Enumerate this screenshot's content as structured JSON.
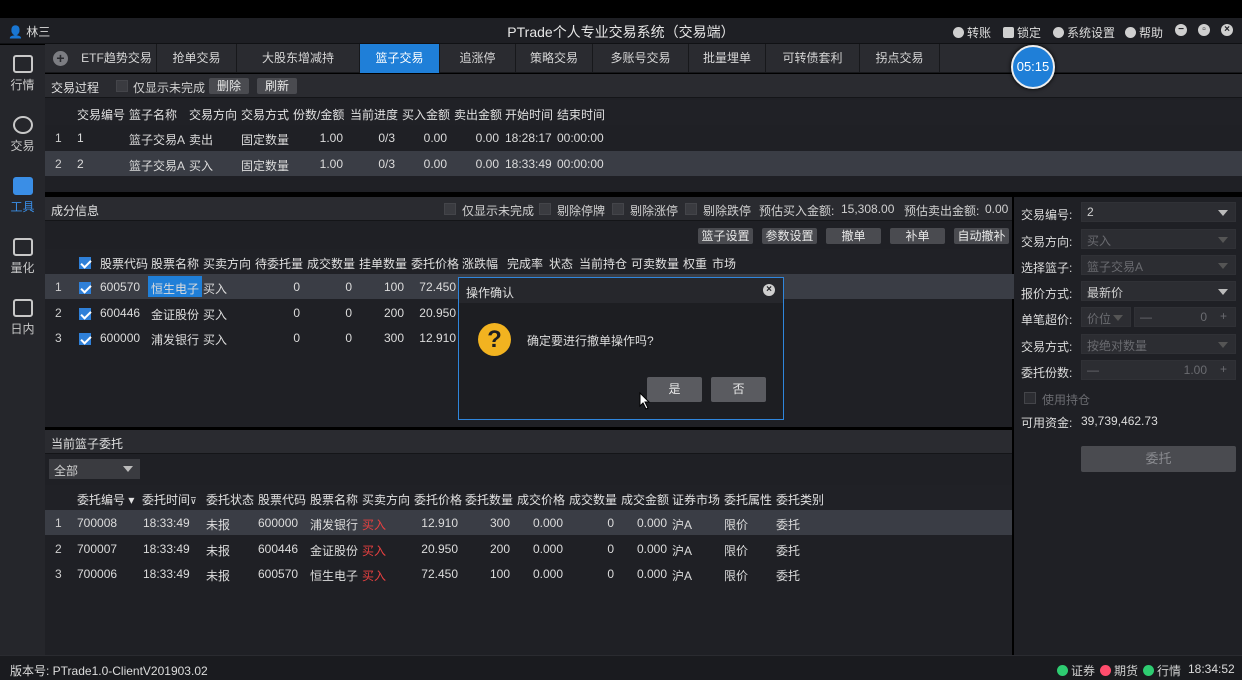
{
  "window": {
    "user": "林三",
    "title": "PTrade个人专业交易系统（交易端）",
    "actions": [
      "转账",
      "锁定",
      "系统设置",
      "帮助"
    ]
  },
  "sidebar": [
    {
      "label": "行情",
      "icon": "chart-icon"
    },
    {
      "label": "交易",
      "icon": "yen-icon"
    },
    {
      "label": "工具",
      "icon": "toolbox-icon"
    },
    {
      "label": "量化",
      "icon": "quant-icon"
    },
    {
      "label": "日内",
      "icon": "intraday-icon"
    }
  ],
  "tabs": [
    "ETF趋势交易",
    "抢单交易",
    "大股东增减持",
    "篮子交易",
    "追涨停",
    "策略交易",
    "多账号交易",
    "批量埋单",
    "可转债套利",
    "拐点交易"
  ],
  "active_tab": "篮子交易",
  "timer": "05:15",
  "process": {
    "title": "交易过程",
    "only_unfinished": "仅显示未完成",
    "delete_btn": "删除",
    "refresh_btn": "刷新",
    "headers": [
      "交易编号",
      "篮子名称",
      "交易方向",
      "交易方式",
      "份数/金额",
      "当前进度",
      "买入金额",
      "卖出金额",
      "开始时间",
      "结束时间"
    ],
    "rows": [
      {
        "n": "1",
        "id": "1",
        "name": "篮子交易A",
        "dir": "卖出",
        "mode": "固定数量",
        "qty": "1.00",
        "prog": "0/3",
        "buy": "0.00",
        "sell": "0.00",
        "start": "18:28:17",
        "end": "00:00:00"
      },
      {
        "n": "2",
        "id": "2",
        "name": "篮子交易A",
        "dir": "买入",
        "mode": "固定数量",
        "qty": "1.00",
        "prog": "0/3",
        "buy": "0.00",
        "sell": "0.00",
        "start": "18:33:49",
        "end": "00:00:00"
      }
    ]
  },
  "components": {
    "title": "成分信息",
    "filters": [
      "仅显示未完成",
      "剔除停牌",
      "剔除涨停",
      "剔除跌停"
    ],
    "est_buy_label": "预估买入金额:",
    "est_buy": "15,308.00",
    "est_sell_label": "预估卖出金额:",
    "est_sell": "0.00",
    "buttons": [
      "篮子设置",
      "参数设置",
      "撤单",
      "补单",
      "自动撤补"
    ],
    "headers": [
      "股票代码",
      "股票名称",
      "买卖方向",
      "待委托量",
      "成交数量",
      "挂单数量",
      "委托价格",
      "涨跌幅",
      "完成率",
      "状态",
      "当前持仓",
      "可卖数量",
      "权重",
      "市场"
    ],
    "rows": [
      {
        "n": "1",
        "code": "600570",
        "name": "恒生电子",
        "dir": "买入",
        "pending": "0",
        "filled": "0",
        "order": "100",
        "price": "72.450"
      },
      {
        "n": "2",
        "code": "600446",
        "name": "金证股份",
        "dir": "买入",
        "pending": "0",
        "filled": "0",
        "order": "200",
        "price": "20.950"
      },
      {
        "n": "3",
        "code": "600000",
        "name": "浦发银行",
        "dir": "买入",
        "pending": "0",
        "filled": "0",
        "order": "300",
        "price": "12.910"
      }
    ]
  },
  "dialog": {
    "title": "操作确认",
    "message": "确定要进行撤单操作吗?",
    "yes": "是",
    "no": "否"
  },
  "orders": {
    "title": "当前篮子委托",
    "filter": "全部",
    "headers": [
      "委托编号",
      "委托时间",
      "委托状态",
      "股票代码",
      "股票名称",
      "买卖方向",
      "委托价格",
      "委托数量",
      "成交价格",
      "成交数量",
      "成交金额",
      "证券市场",
      "委托属性",
      "委托类别"
    ],
    "rows": [
      {
        "n": "1",
        "id": "700008",
        "time": "18:33:49",
        "status": "未报",
        "code": "600000",
        "name": "浦发银行",
        "dir": "买入",
        "price": "12.910",
        "qty": "300",
        "fprice": "0.000",
        "fqty": "0",
        "famt": "0.000",
        "mkt": "沪A",
        "attr": "限价",
        "type": "委托"
      },
      {
        "n": "2",
        "id": "700007",
        "time": "18:33:49",
        "status": "未报",
        "code": "600446",
        "name": "金证股份",
        "dir": "买入",
        "price": "20.950",
        "qty": "200",
        "fprice": "0.000",
        "fqty": "0",
        "famt": "0.000",
        "mkt": "沪A",
        "attr": "限价",
        "type": "委托"
      },
      {
        "n": "3",
        "id": "700006",
        "time": "18:33:49",
        "status": "未报",
        "code": "600570",
        "name": "恒生电子",
        "dir": "买入",
        "price": "72.450",
        "qty": "100",
        "fprice": "0.000",
        "fqty": "0",
        "famt": "0.000",
        "mkt": "沪A",
        "attr": "限价",
        "type": "委托"
      }
    ]
  },
  "right_panel": {
    "trade_no_label": "交易编号:",
    "trade_no": "2",
    "direction_label": "交易方向:",
    "direction": "买入",
    "basket_label": "选择篮子:",
    "basket": "篮子交易A",
    "price_mode_label": "报价方式:",
    "price_mode": "最新价",
    "overprice_label": "单笔超价:",
    "overprice_unit": "价位",
    "overprice_value": "0",
    "trade_mode_label": "交易方式:",
    "trade_mode": "按绝对数量",
    "shares_label": "委托份数:",
    "shares_value": "1.00",
    "use_position": "使用持仓",
    "funds_label": "可用资金:",
    "funds": "39,739,462.73",
    "submit": "委托"
  },
  "status": {
    "version": "版本号:  PTrade1.0-ClientV201903.02",
    "ind1": "证券",
    "ind1_color": "#2ecc71",
    "ind2": "期货",
    "ind2_color": "#ff4d6d",
    "ind3": "行情",
    "ind3_color": "#2ecc71",
    "time": "18:34:52"
  }
}
